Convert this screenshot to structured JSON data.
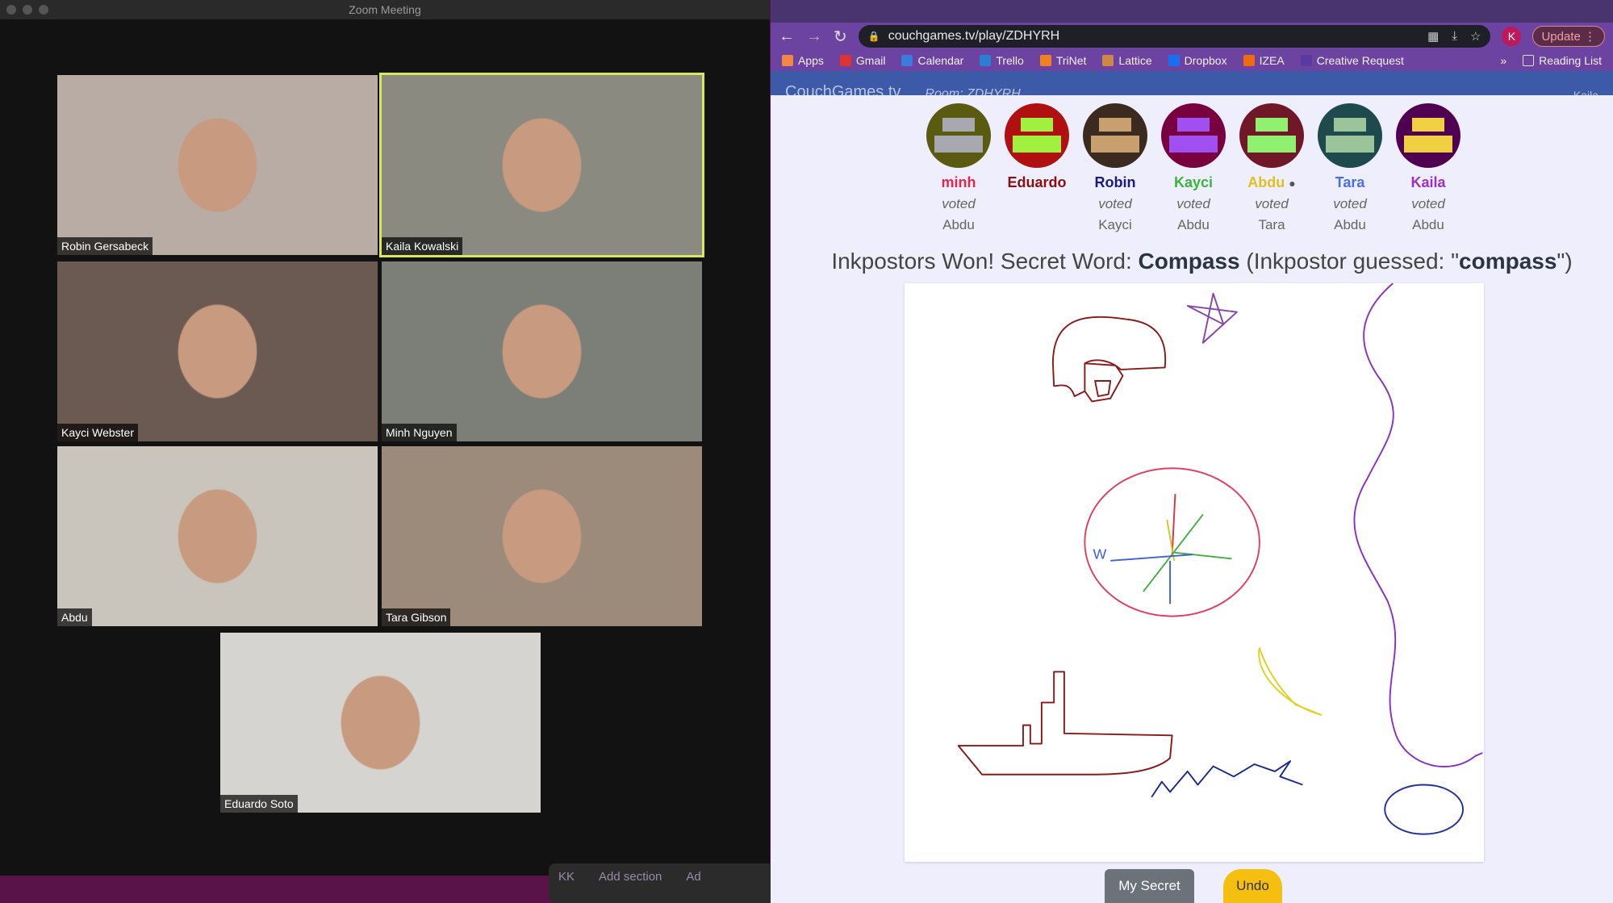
{
  "zoom": {
    "title": "Zoom Meeting",
    "participants": [
      {
        "name": "Robin Gersabeck",
        "bg": "#b8aca4"
      },
      {
        "name": "Kaila Kowalski",
        "bg": "#8a8a80",
        "active": true
      },
      {
        "name": "Kayci Webster",
        "bg": "#6b5a52"
      },
      {
        "name": "Minh Nguyen",
        "bg": "#7c7e78"
      },
      {
        "name": "Abdu",
        "bg": "#c9c4bc"
      },
      {
        "name": "Tara Gibson",
        "bg": "#9c8a7a"
      },
      {
        "name": "Eduardo Soto",
        "bg": "#d6d4d0"
      }
    ],
    "bottom_bar": {
      "initials": "KK",
      "add_section": "Add section",
      "partial": "Ad"
    }
  },
  "browser": {
    "url": "couchgames.tv/play/ZDHYRH",
    "profile_initial": "K",
    "update_label": "Update",
    "bookmarks": [
      {
        "label": "Apps",
        "color": "#e84"
      },
      {
        "label": "Gmail",
        "color": "#d33"
      },
      {
        "label": "Calendar",
        "color": "#3b7be0"
      },
      {
        "label": "Trello",
        "color": "#2a7fd4"
      },
      {
        "label": "TriNet",
        "color": "#f08020"
      },
      {
        "label": "Lattice",
        "color": "#c84"
      },
      {
        "label": "Dropbox",
        "color": "#1a6ff0"
      },
      {
        "label": "IZEA",
        "color": "#f06a10"
      },
      {
        "label": "Creative Request",
        "color": "#5a3aa0"
      }
    ],
    "overflow": "»",
    "reading_list": "Reading List"
  },
  "site": {
    "brand": "CouchGames.tv",
    "room": "Room: ZDHYRH",
    "user": "Kaila"
  },
  "players": [
    {
      "name": "minh",
      "color": "#e0284a",
      "voted": "voted",
      "target": "Abdu",
      "avatar_bg": "#5a5a10",
      "avatar_fg": "#a8a8b0"
    },
    {
      "name": "Eduardo",
      "color": "#8a1010",
      "voted": "",
      "target": "",
      "avatar_bg": "#b01010",
      "avatar_fg": "#a0f040"
    },
    {
      "name": "Robin",
      "color": "#1a1a80",
      "voted": "voted",
      "target": "Kayci",
      "avatar_bg": "#3a2a20",
      "avatar_fg": "#c8a070"
    },
    {
      "name": "Kayci",
      "color": "#3cb43c",
      "voted": "voted",
      "target": "Abdu",
      "avatar_bg": "#780040",
      "avatar_fg": "#a050f0"
    },
    {
      "name": "Abdu",
      "color": "#e0c020",
      "voted": "voted",
      "target": "Tara",
      "avatar_bg": "#701828",
      "avatar_fg": "#90f070",
      "host": true
    },
    {
      "name": "Tara",
      "color": "#4a70e0",
      "voted": "voted",
      "target": "Abdu",
      "avatar_bg": "#1e4a4e",
      "avatar_fg": "#9cc49a"
    },
    {
      "name": "Kaila",
      "color": "#a030c0",
      "voted": "voted",
      "target": "Abdu",
      "avatar_bg": "#500050",
      "avatar_fg": "#f0d040"
    }
  ],
  "result": {
    "prefix": "Inkpostors Won! Secret Word: ",
    "word": "Compass",
    "mid": " (Inkpostor guessed: \"",
    "guess": "compass",
    "suffix": "\")"
  },
  "buttons": {
    "my_secret": "My Secret",
    "undo": "Undo"
  },
  "drawing_label": "W"
}
